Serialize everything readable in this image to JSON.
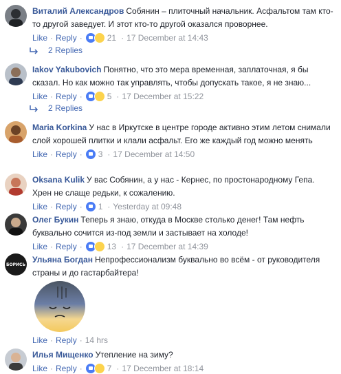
{
  "comments": [
    {
      "name": "Виталий Александров",
      "text": "Собянин – плиточный начальник. Асфальтом там кто-то другой заведует. И этот кто-то другой оказался проворнее.",
      "reactions": "21",
      "time": "17 December at 14:43",
      "replies": "2 Replies",
      "reaction_icons": [
        "like-icon",
        "wow-icon"
      ]
    },
    {
      "name": "Iakov Yakubovich",
      "text": "Понятно, что это мера временная, заплаточная, я бы сказал. Но как можно так управлять, чтобы допускать такое, я не знаю...",
      "reactions": "5",
      "time": "17 December at 15:22",
      "replies": "2 Replies",
      "reaction_icons": [
        "like-icon",
        "wow-icon"
      ]
    },
    {
      "name": "Maria Korkina",
      "text": "У нас в Иркутске в центре городе активно этим летом снимали слой хорошей плитки и клали асфальт. Его же каждый год можно менять",
      "reactions": "3",
      "time": "17 December at 14:50",
      "reaction_icons": [
        "like-icon"
      ]
    },
    {
      "name": "Oksana Kulik",
      "text": "У вас Собянин, а у нас - Кернес, по простонародному Гепа. Хрен не слаще редьки, к сожалению.",
      "reactions": "1",
      "time": "Yesterday at 09:48",
      "reaction_icons": [
        "like-icon"
      ]
    },
    {
      "name": "Олег Букин",
      "text": "Теперь я знаю, откуда в Москве столько денег! Там нефть буквально сочится из-под земли и застывает на холоде!",
      "reactions": "13",
      "time": "17 December at 14:39",
      "reaction_icons": [
        "like-icon",
        "wow-icon"
      ]
    },
    {
      "name": "Ульяна Богдан",
      "text": "Непрофессионализм буквально во всём - от руководителя страны и до гастарбайтера!",
      "time": "14 hrs",
      "avatar_text": "БОРИСЬ"
    },
    {
      "name": "Илья Мищенко",
      "text": "Утепление на зиму?",
      "reactions": "7",
      "time": "17 December at 18:14",
      "reaction_icons": [
        "like-icon",
        "wow-icon"
      ]
    }
  ],
  "labels": {
    "like": "Like",
    "reply": "Reply"
  },
  "colors": {
    "name": "#385898",
    "link": "#4267b2",
    "meta": "#90949c",
    "text": "#1d2129"
  }
}
